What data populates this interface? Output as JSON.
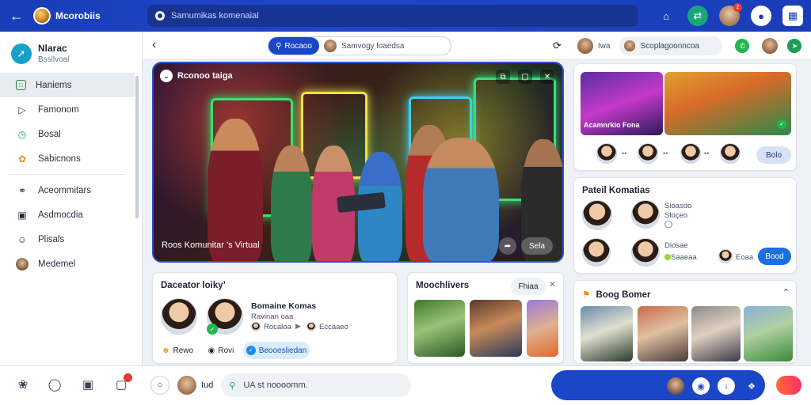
{
  "topbar": {
    "title": "Mcorobiis",
    "search_text": "Samumikas komenaial",
    "badge_count": "2"
  },
  "sidebar": {
    "app_name": "Nlarac",
    "app_sub": "Bssllvoal",
    "items": [
      {
        "label": "Haniems",
        "icon": "home-icon",
        "active": true
      },
      {
        "label": "Famonom",
        "icon": "tag-icon"
      },
      {
        "label": "Bosal",
        "icon": "clock-icon"
      },
      {
        "label": "Sabicnons",
        "icon": "gear-icon"
      },
      {
        "label": "Aceommitars",
        "icon": "people-icon"
      },
      {
        "label": "Asdmocdia",
        "icon": "image-icon"
      },
      {
        "label": "Plisals",
        "icon": "smile-icon"
      },
      {
        "label": "Medemel",
        "icon": "avatar-icon"
      }
    ]
  },
  "subbar": {
    "tab_active": "Rocaoo",
    "tab_text": "Samvogy loaedsa",
    "right_label": "Iwa",
    "right_pill": "Scoplagoonncoa"
  },
  "video": {
    "title": "Rconoo taiga",
    "caption": "Roos Komunitar ’s Virtual",
    "pill": "Sela"
  },
  "card_activity": {
    "title": "Daceator loiky’",
    "name": "Bomaine Komas",
    "sub": "Ravinan oaa",
    "meta1": "Rocaloa",
    "meta2": "Eccaaeo",
    "reaction1": "Rewo",
    "reaction2": "Rovi",
    "action": "Beooesliedan"
  },
  "card_moments": {
    "title": "Moochlivers",
    "btn": "Fhiaa"
  },
  "card_featured": {
    "banner": "Acamnrkio Fona",
    "pill": "Bolo"
  },
  "card_members": {
    "title": "Pateil Komatias",
    "m1": "Sioasdo",
    "m1s": "Sloçeo",
    "m2": "Diosae",
    "m2s": "Saaeaa",
    "m3": "Eoaa",
    "btn": "Bood"
  },
  "card_events": {
    "title": "Boog Bomer"
  },
  "bottombar": {
    "who": "Iud",
    "compose": "UA st noooomm."
  }
}
